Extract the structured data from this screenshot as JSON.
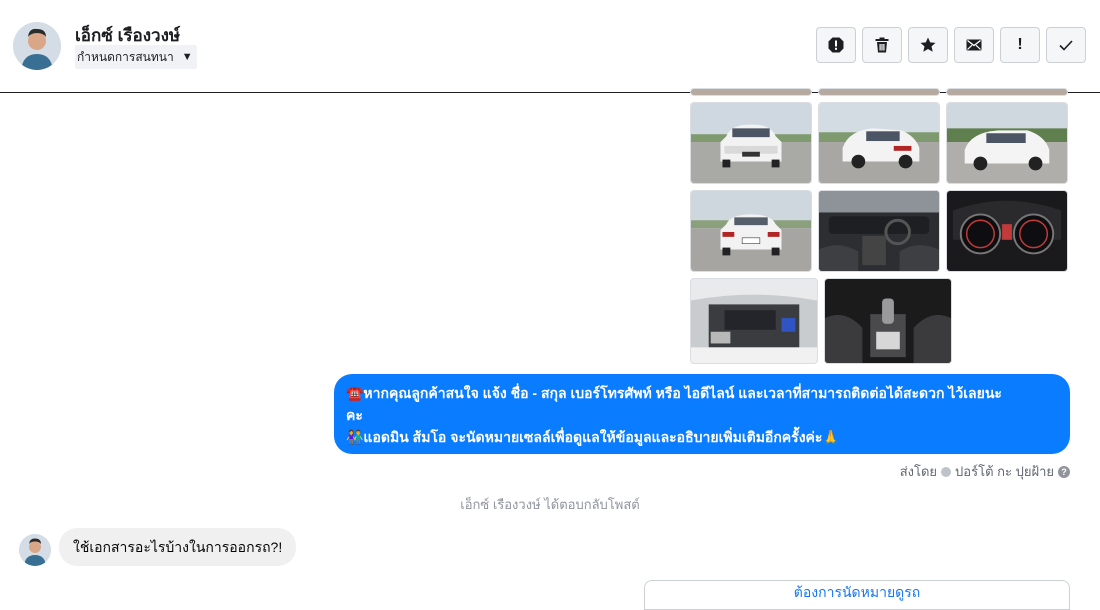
{
  "header": {
    "contact_name": "เอ็กซ์ เรืองวงษ์",
    "label_dropdown": "กำหนดการสนทนา",
    "actions": [
      {
        "name": "report-spam-button",
        "icon": "exclamation-circle-icon"
      },
      {
        "name": "delete-button",
        "icon": "trash-icon"
      },
      {
        "name": "star-button",
        "icon": "star-icon"
      },
      {
        "name": "mark-unread-button",
        "icon": "envelope-icon"
      },
      {
        "name": "follow-up-button",
        "icon": "exclamation-icon",
        "glyph": "!"
      },
      {
        "name": "mark-done-button",
        "icon": "check-icon",
        "glyph": "✓"
      }
    ]
  },
  "photos": [
    {
      "name": "car-photo-front",
      "kind": "exterior-front"
    },
    {
      "name": "car-photo-rear-three-quarter",
      "kind": "exterior-rear"
    },
    {
      "name": "car-photo-front-three-quarter",
      "kind": "exterior-front"
    },
    {
      "name": "car-photo-rear",
      "kind": "exterior-rear"
    },
    {
      "name": "car-photo-dashboard",
      "kind": "interior-dash"
    },
    {
      "name": "car-photo-gauges",
      "kind": "gauges"
    },
    {
      "name": "car-photo-engine",
      "kind": "engine"
    },
    {
      "name": "car-photo-gear-shifter",
      "kind": "shifter"
    }
  ],
  "messages": {
    "outgoing_lines": [
      "☎️หากคุณลูกค้าสนใจ แจ้ง ชื่อ - สกุล เบอร์โทรศัพท์ หรือ ไอดีไลน์ และเวลาที่สามารถติดต่อได้สะดวก ไว้เลยนะ",
      "คะ",
      "👫แอดมิน ส้มโอ จะนัดหมายเซลล์เพื่อดูแลให้ข้อมูลและอธิบายเพิ่มเติมอีกครั้งค่ะ🙏"
    ],
    "sent_by_prefix": "ส่งโดย",
    "sent_by_name": "ปอร์โต้ กะ ปุยฝ้าย",
    "help_glyph": "?",
    "system_note": "เอ็กซ์ เรืองวงษ์ ได้ตอบกลับโพสต์",
    "incoming_text": "ใช้เอกสารอะไรบ้างในการออกรถ?!",
    "partial_card_text": "ต้องการนัดหมายดูรถ"
  },
  "colors": {
    "outgoing_bubble": "#0a7cff",
    "incoming_bubble": "#f0f0f0",
    "link_blue": "#1877f2"
  }
}
